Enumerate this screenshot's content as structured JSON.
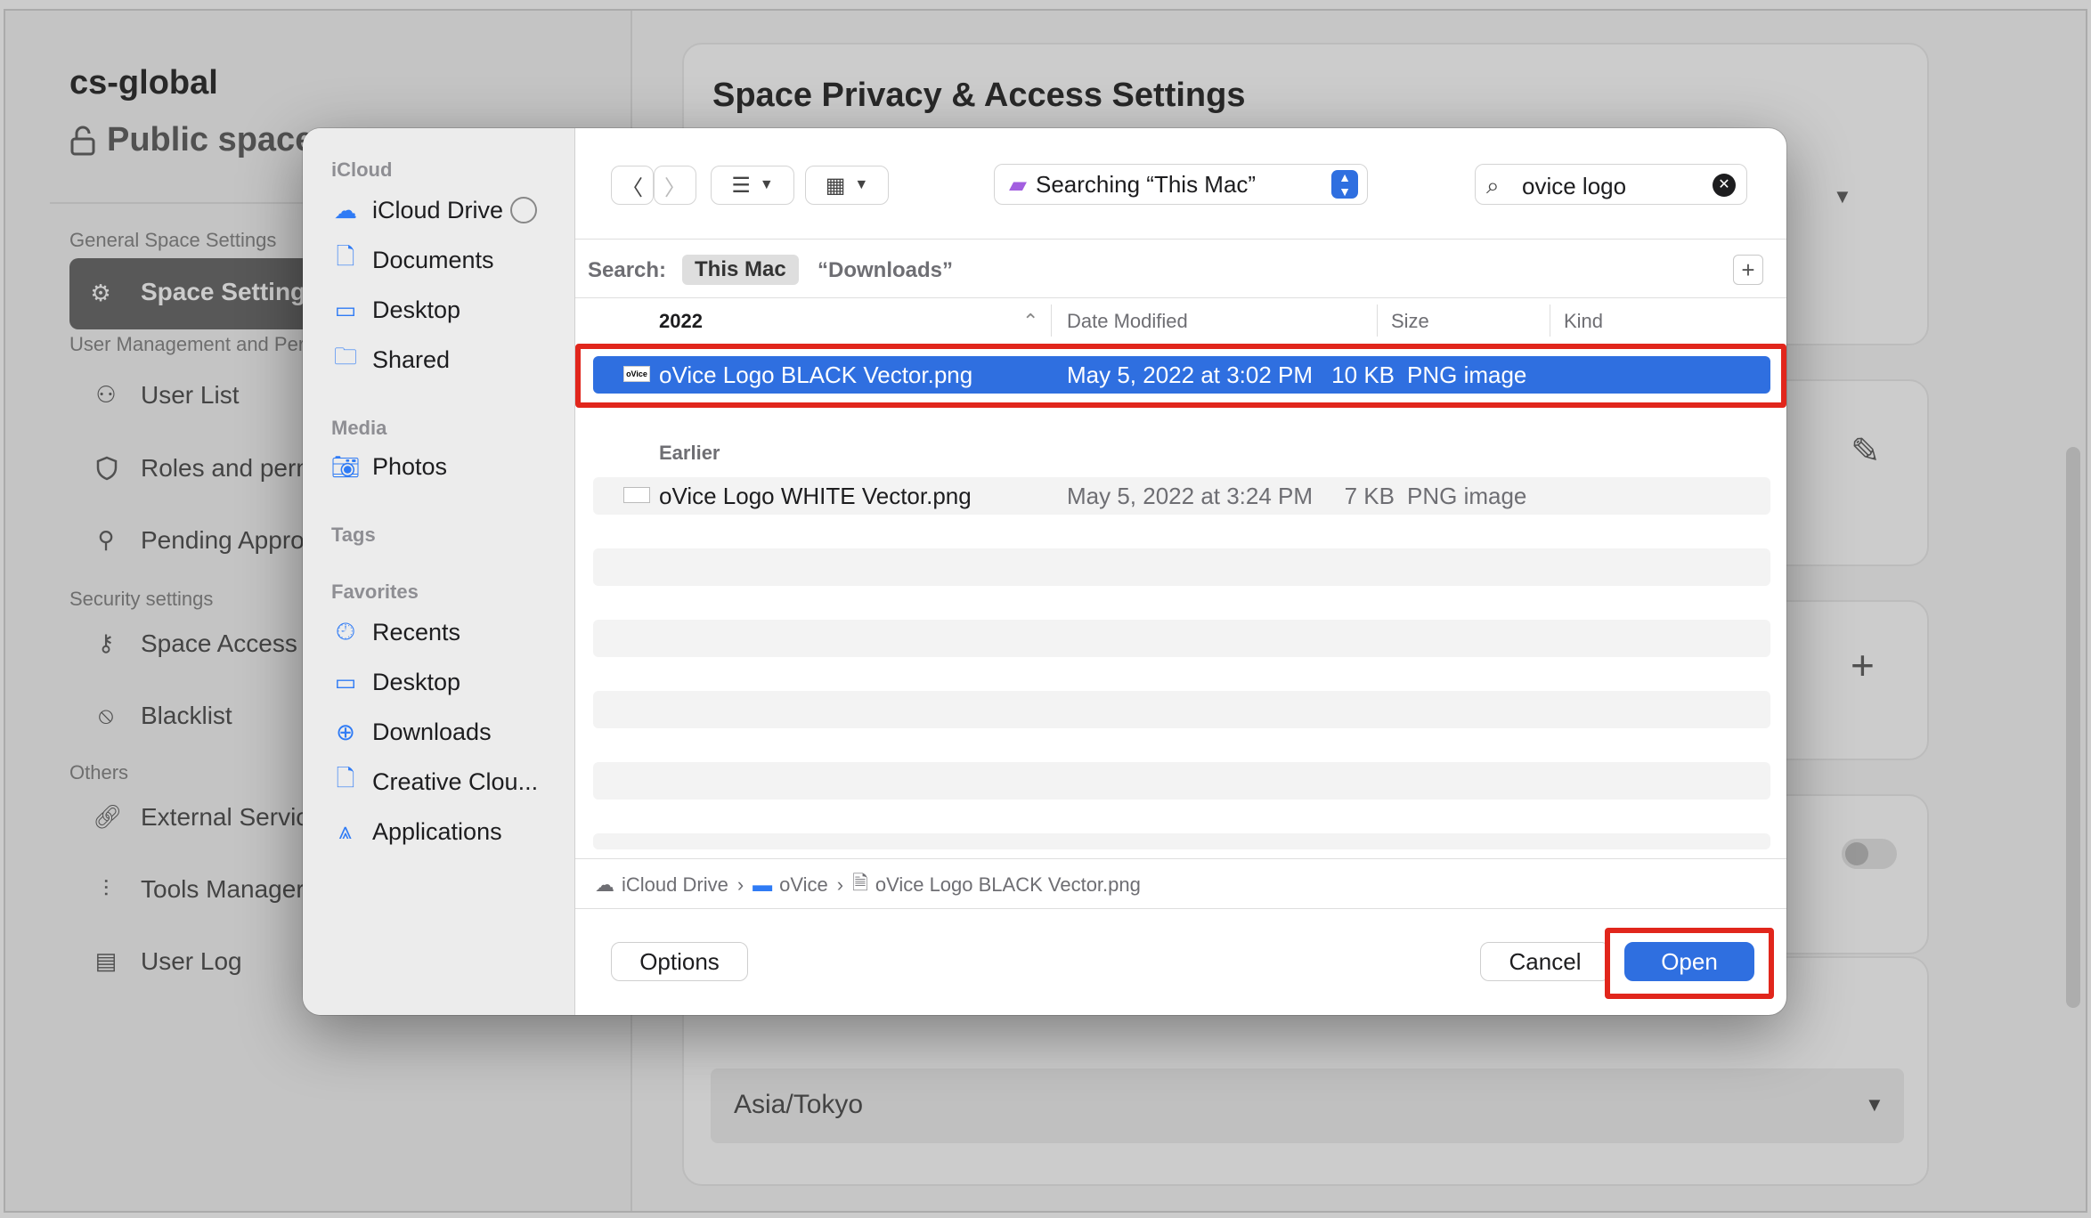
{
  "background": {
    "space_name": "cs-global",
    "space_type": "Public space",
    "sidebar": {
      "groups": [
        {
          "heading": "General Space Settings",
          "items": [
            {
              "label": "Space Settings",
              "icon": "gear-icon",
              "active": true
            }
          ]
        },
        {
          "heading": "User Management and Per",
          "items": [
            {
              "label": "User List",
              "icon": "users-icon"
            },
            {
              "label": "Roles and perm",
              "icon": "shield-icon"
            },
            {
              "label": "Pending Approv",
              "icon": "user-plus-icon"
            }
          ]
        },
        {
          "heading": "Security settings",
          "items": [
            {
              "label": "Space Access Se",
              "icon": "key-icon"
            },
            {
              "label": "Blacklist",
              "icon": "ban-icon"
            }
          ]
        },
        {
          "heading": "Others",
          "items": [
            {
              "label": "External Service",
              "icon": "link-icon"
            },
            {
              "label": "Tools Manager",
              "icon": "sliders-icon"
            },
            {
              "label": "User Log",
              "icon": "log-icon"
            }
          ]
        }
      ]
    },
    "main": {
      "title": "Space Privacy & Access Settings",
      "timezone_value": "Asia/Tokyo"
    }
  },
  "dialog": {
    "sidebar": {
      "sections": [
        {
          "heading": "iCloud",
          "items": [
            {
              "label": "iCloud Drive",
              "icon": "cloud-icon"
            },
            {
              "label": "Documents",
              "icon": "document-icon"
            },
            {
              "label": "Desktop",
              "icon": "desktop-icon"
            },
            {
              "label": "Shared",
              "icon": "shared-folder-icon"
            }
          ]
        },
        {
          "heading": "Media",
          "items": [
            {
              "label": "Photos",
              "icon": "camera-icon"
            }
          ]
        },
        {
          "heading": "Tags",
          "items": []
        },
        {
          "heading": "Favorites",
          "items": [
            {
              "label": "Recents",
              "icon": "clock-icon"
            },
            {
              "label": "Desktop",
              "icon": "desktop-icon"
            },
            {
              "label": "Downloads",
              "icon": "download-icon"
            },
            {
              "label": "Creative Clou...",
              "icon": "document-icon"
            },
            {
              "label": "Applications",
              "icon": "applications-icon"
            }
          ]
        }
      ]
    },
    "toolbar": {
      "location": "Searching “This Mac”",
      "search_value": "ovice logo"
    },
    "scope": {
      "label": "Search:",
      "this_mac": "This Mac",
      "downloads": "“Downloads”"
    },
    "columns": {
      "name": "2022",
      "date": "Date Modified",
      "size": "Size",
      "kind": "Kind"
    },
    "groups": [
      {
        "heading": "2022",
        "files": [
          {
            "name": "oVice Logo BLACK Vector.png",
            "date": "May 5, 2022 at 3:02 PM",
            "size": "10 KB",
            "kind": "PNG image",
            "selected": true
          }
        ]
      },
      {
        "heading": "Earlier",
        "files": [
          {
            "name": "oVice Logo WHITE Vector.png",
            "date": "May 5, 2022 at 3:24 PM",
            "size": "7 KB",
            "kind": "PNG image",
            "selected": false
          }
        ]
      }
    ],
    "path": [
      "iCloud Drive",
      "oVice",
      "oVice Logo BLACK Vector.png"
    ],
    "buttons": {
      "options": "Options",
      "cancel": "Cancel",
      "open": "Open"
    }
  },
  "colors": {
    "accent": "#2f6fe0",
    "highlight": "#e1261c",
    "sidebar_active": "#6f6f6f"
  }
}
